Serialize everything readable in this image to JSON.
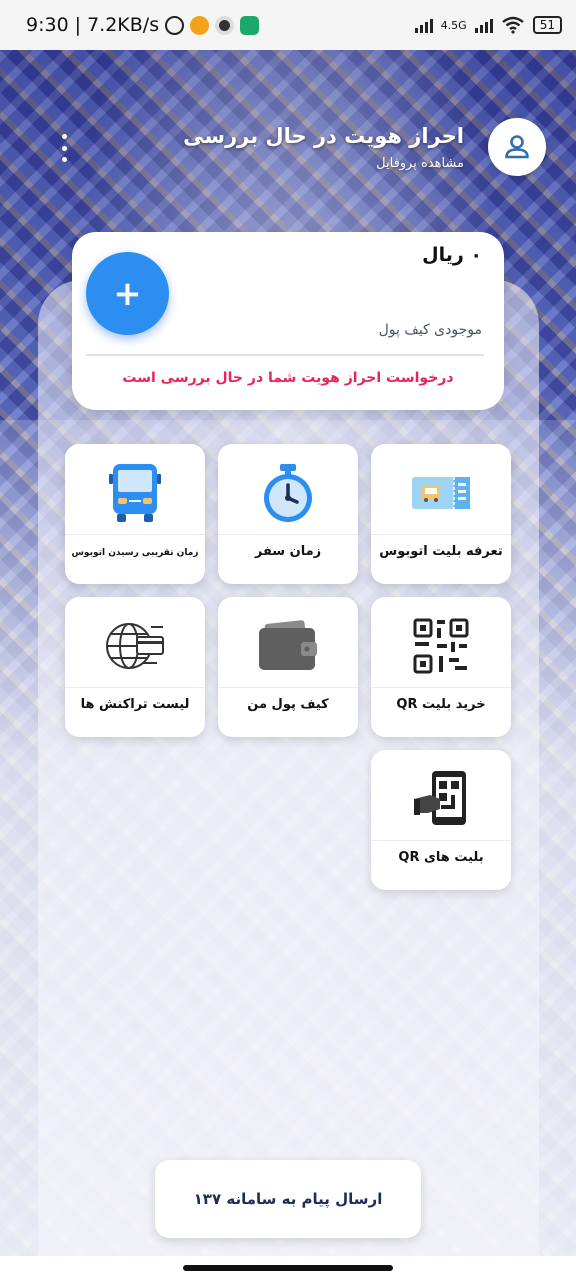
{
  "status_bar": {
    "time": "9:30",
    "speed": "7.2KB/s",
    "network": "4.5G",
    "battery": "51"
  },
  "header": {
    "title": "احراز هویت در حال بررسی",
    "subtitle": "مشاهده پروفایل"
  },
  "wallet": {
    "amount": "۰ ریال",
    "label": "موجودی کیف پول",
    "status": "درخواست احراز هویت شما در حال بررسی است",
    "add_symbol": "+"
  },
  "tiles": [
    {
      "label": "تعرفه بلیت اتوبوس",
      "icon": "ticket-icon"
    },
    {
      "label": "زمان سفر",
      "icon": "stopwatch-icon"
    },
    {
      "label": "زمان تقریبی رسیدن اتوبوس",
      "icon": "bus-icon"
    },
    {
      "label": "خرید بلیت QR",
      "icon": "qr-code-icon"
    },
    {
      "label": "کیف پول من",
      "icon": "wallet-icon"
    },
    {
      "label": "لیست تراکنش ها",
      "icon": "globe-card-icon"
    },
    {
      "label": "بلیت های QR",
      "icon": "phone-qr-icon"
    }
  ],
  "send_message": "ارسال پیام به سامانه ۱۳۷",
  "colors": {
    "accent_blue": "#2b8ef0",
    "alert_pink": "#e8245a",
    "avatar_icon": "#2b6fb0"
  }
}
